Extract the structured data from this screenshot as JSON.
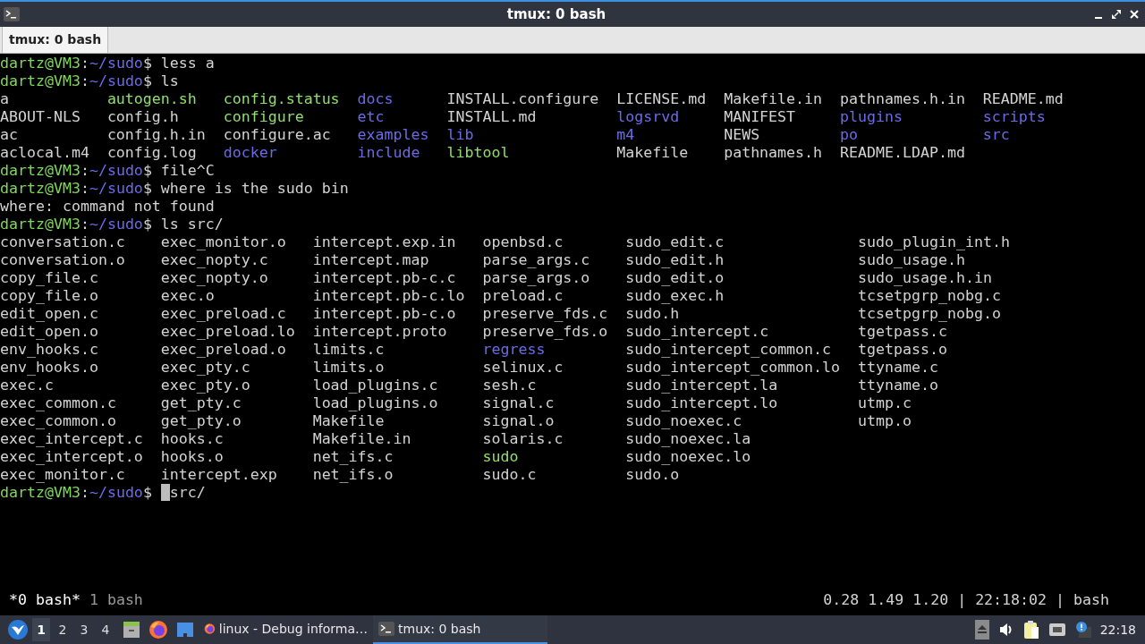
{
  "window": {
    "title": "tmux: 0 bash"
  },
  "tabs": [
    {
      "label": "tmux: 0 bash",
      "selected": true
    }
  ],
  "terminal": {
    "lines": [
      {
        "kind": "prompt",
        "user": "dartz@VM3",
        "sep": ":",
        "path": "~/sudo",
        "sigil": "$",
        "command": "less a",
        "cursor": false
      },
      {
        "kind": "prompt",
        "user": "dartz@VM3",
        "sep": ":",
        "path": "~/sudo",
        "sigil": "$",
        "command": "ls",
        "cursor": false
      },
      {
        "kind": "listing",
        "columns": [
          [
            {
              "name": "a",
              "kind": "file"
            },
            {
              "name": "ABOUT-NLS",
              "kind": "file"
            },
            {
              "name": "ac",
              "kind": "file"
            },
            {
              "name": "aclocal.m4",
              "kind": "file"
            }
          ],
          [
            {
              "name": "autogen.sh",
              "kind": "exec"
            },
            {
              "name": "config.h",
              "kind": "file"
            },
            {
              "name": "config.h.in",
              "kind": "file"
            },
            {
              "name": "config.log",
              "kind": "file"
            }
          ],
          [
            {
              "name": "config.status",
              "kind": "exec"
            },
            {
              "name": "configure",
              "kind": "exec"
            },
            {
              "name": "configure.ac",
              "kind": "file"
            },
            {
              "name": "docker",
              "kind": "dir"
            }
          ],
          [
            {
              "name": "docs",
              "kind": "dir"
            },
            {
              "name": "etc",
              "kind": "dir"
            },
            {
              "name": "examples",
              "kind": "dir"
            },
            {
              "name": "include",
              "kind": "dir"
            }
          ],
          [
            {
              "name": "INSTALL.configure",
              "kind": "file"
            },
            {
              "name": "INSTALL.md",
              "kind": "file"
            },
            {
              "name": "lib",
              "kind": "dir"
            },
            {
              "name": "libtool",
              "kind": "exec"
            }
          ],
          [
            {
              "name": "LICENSE.md",
              "kind": "file"
            },
            {
              "name": "logsrvd",
              "kind": "dir"
            },
            {
              "name": "m4",
              "kind": "dir"
            },
            {
              "name": "Makefile",
              "kind": "file"
            }
          ],
          [
            {
              "name": "Makefile.in",
              "kind": "file"
            },
            {
              "name": "MANIFEST",
              "kind": "file"
            },
            {
              "name": "NEWS",
              "kind": "file"
            },
            {
              "name": "pathnames.h",
              "kind": "file"
            }
          ],
          [
            {
              "name": "pathnames.h.in",
              "kind": "file"
            },
            {
              "name": "plugins",
              "kind": "dir"
            },
            {
              "name": "po",
              "kind": "dir"
            },
            {
              "name": "README.LDAP.md",
              "kind": "file"
            }
          ],
          [
            {
              "name": "README.md",
              "kind": "file"
            },
            {
              "name": "scripts",
              "kind": "dir"
            },
            {
              "name": "src",
              "kind": "dir"
            }
          ]
        ]
      },
      {
        "kind": "prompt",
        "user": "dartz@VM3",
        "sep": ":",
        "path": "~/sudo",
        "sigil": "$",
        "command": "file^C",
        "cursor": false
      },
      {
        "kind": "prompt",
        "user": "dartz@VM3",
        "sep": ":",
        "path": "~/sudo",
        "sigil": "$",
        "command": "where is the sudo bin",
        "cursor": false
      },
      {
        "kind": "output",
        "text": "where: command not found"
      },
      {
        "kind": "prompt",
        "user": "dartz@VM3",
        "sep": ":",
        "path": "~/sudo",
        "sigil": "$",
        "command": "ls src/",
        "cursor": false
      },
      {
        "kind": "listing",
        "columns": [
          [
            {
              "name": "conversation.c",
              "kind": "file"
            },
            {
              "name": "conversation.o",
              "kind": "file"
            },
            {
              "name": "copy_file.c",
              "kind": "file"
            },
            {
              "name": "copy_file.o",
              "kind": "file"
            },
            {
              "name": "edit_open.c",
              "kind": "file"
            },
            {
              "name": "edit_open.o",
              "kind": "file"
            },
            {
              "name": "env_hooks.c",
              "kind": "file"
            },
            {
              "name": "env_hooks.o",
              "kind": "file"
            },
            {
              "name": "exec.c",
              "kind": "file"
            },
            {
              "name": "exec_common.c",
              "kind": "file"
            },
            {
              "name": "exec_common.o",
              "kind": "file"
            },
            {
              "name": "exec_intercept.c",
              "kind": "file"
            },
            {
              "name": "exec_intercept.o",
              "kind": "file"
            },
            {
              "name": "exec_monitor.c",
              "kind": "file"
            }
          ],
          [
            {
              "name": "exec_monitor.o",
              "kind": "file"
            },
            {
              "name": "exec_nopty.c",
              "kind": "file"
            },
            {
              "name": "exec_nopty.o",
              "kind": "file"
            },
            {
              "name": "exec.o",
              "kind": "file"
            },
            {
              "name": "exec_preload.c",
              "kind": "file"
            },
            {
              "name": "exec_preload.lo",
              "kind": "file"
            },
            {
              "name": "exec_preload.o",
              "kind": "file"
            },
            {
              "name": "exec_pty.c",
              "kind": "file"
            },
            {
              "name": "exec_pty.o",
              "kind": "file"
            },
            {
              "name": "get_pty.c",
              "kind": "file"
            },
            {
              "name": "get_pty.o",
              "kind": "file"
            },
            {
              "name": "hooks.c",
              "kind": "file"
            },
            {
              "name": "hooks.o",
              "kind": "file"
            },
            {
              "name": "intercept.exp",
              "kind": "file"
            }
          ],
          [
            {
              "name": "intercept.exp.in",
              "kind": "file"
            },
            {
              "name": "intercept.map",
              "kind": "file"
            },
            {
              "name": "intercept.pb-c.c",
              "kind": "file"
            },
            {
              "name": "intercept.pb-c.lo",
              "kind": "file"
            },
            {
              "name": "intercept.pb-c.o",
              "kind": "file"
            },
            {
              "name": "intercept.proto",
              "kind": "file"
            },
            {
              "name": "limits.c",
              "kind": "file"
            },
            {
              "name": "limits.o",
              "kind": "file"
            },
            {
              "name": "load_plugins.c",
              "kind": "file"
            },
            {
              "name": "load_plugins.o",
              "kind": "file"
            },
            {
              "name": "Makefile",
              "kind": "file"
            },
            {
              "name": "Makefile.in",
              "kind": "file"
            },
            {
              "name": "net_ifs.c",
              "kind": "file"
            },
            {
              "name": "net_ifs.o",
              "kind": "file"
            }
          ],
          [
            {
              "name": "openbsd.c",
              "kind": "file"
            },
            {
              "name": "parse_args.c",
              "kind": "file"
            },
            {
              "name": "parse_args.o",
              "kind": "file"
            },
            {
              "name": "preload.c",
              "kind": "file"
            },
            {
              "name": "preserve_fds.c",
              "kind": "file"
            },
            {
              "name": "preserve_fds.o",
              "kind": "file"
            },
            {
              "name": "regress",
              "kind": "dir"
            },
            {
              "name": "selinux.c",
              "kind": "file"
            },
            {
              "name": "sesh.c",
              "kind": "file"
            },
            {
              "name": "signal.c",
              "kind": "file"
            },
            {
              "name": "signal.o",
              "kind": "file"
            },
            {
              "name": "solaris.c",
              "kind": "file"
            },
            {
              "name": "sudo",
              "kind": "exec"
            },
            {
              "name": "sudo.c",
              "kind": "file"
            }
          ],
          [
            {
              "name": "sudo_edit.c",
              "kind": "file"
            },
            {
              "name": "sudo_edit.h",
              "kind": "file"
            },
            {
              "name": "sudo_edit.o",
              "kind": "file"
            },
            {
              "name": "sudo_exec.h",
              "kind": "file"
            },
            {
              "name": "sudo.h",
              "kind": "file"
            },
            {
              "name": "sudo_intercept.c",
              "kind": "file"
            },
            {
              "name": "sudo_intercept_common.c",
              "kind": "file"
            },
            {
              "name": "sudo_intercept_common.lo",
              "kind": "file"
            },
            {
              "name": "sudo_intercept.la",
              "kind": "file"
            },
            {
              "name": "sudo_intercept.lo",
              "kind": "file"
            },
            {
              "name": "sudo_noexec.c",
              "kind": "file"
            },
            {
              "name": "sudo_noexec.la",
              "kind": "file"
            },
            {
              "name": "sudo_noexec.lo",
              "kind": "file"
            },
            {
              "name": "sudo.o",
              "kind": "file"
            }
          ],
          [
            {
              "name": "sudo_plugin_int.h",
              "kind": "file"
            },
            {
              "name": "sudo_usage.h",
              "kind": "file"
            },
            {
              "name": "sudo_usage.h.in",
              "kind": "file"
            },
            {
              "name": "tcsetpgrp_nobg.c",
              "kind": "file"
            },
            {
              "name": "tcsetpgrp_nobg.o",
              "kind": "file"
            },
            {
              "name": "tgetpass.c",
              "kind": "file"
            },
            {
              "name": "tgetpass.o",
              "kind": "file"
            },
            {
              "name": "ttyname.c",
              "kind": "file"
            },
            {
              "name": "ttyname.o",
              "kind": "file"
            },
            {
              "name": "utmp.c",
              "kind": "file"
            },
            {
              "name": "utmp.o",
              "kind": "file"
            }
          ]
        ]
      },
      {
        "kind": "prompt",
        "user": "dartz@VM3",
        "sep": ":",
        "path": "~/sudo",
        "sigil": "$",
        "command": "src/",
        "cursor": true
      }
    ]
  },
  "tmux_status": {
    "windows": [
      {
        "label": "*0 bash*",
        "selected": true
      },
      {
        "label": "1 bash",
        "selected": false
      }
    ],
    "right": "0.28 1.49 1.20 | 22:18:02 | bash"
  },
  "taskbar": {
    "workspaces": [
      {
        "label": "1",
        "selected": true
      },
      {
        "label": "2",
        "selected": false
      },
      {
        "label": "3",
        "selected": false
      },
      {
        "label": "4",
        "selected": false
      }
    ],
    "launchers": [
      {
        "kind": "cabinet"
      },
      {
        "kind": "browser"
      },
      {
        "kind": "window"
      }
    ],
    "tasks": [
      {
        "kind": "browser",
        "label": "linux - Debug informa…",
        "selected": false
      },
      {
        "kind": "terminal",
        "label": "tmux: 0 bash",
        "selected": true
      }
    ],
    "tray": [
      {
        "kind": "eject"
      },
      {
        "kind": "speaker"
      },
      {
        "kind": "clipboard"
      },
      {
        "kind": "network"
      },
      {
        "kind": "notification"
      }
    ],
    "clock": "22:18"
  }
}
